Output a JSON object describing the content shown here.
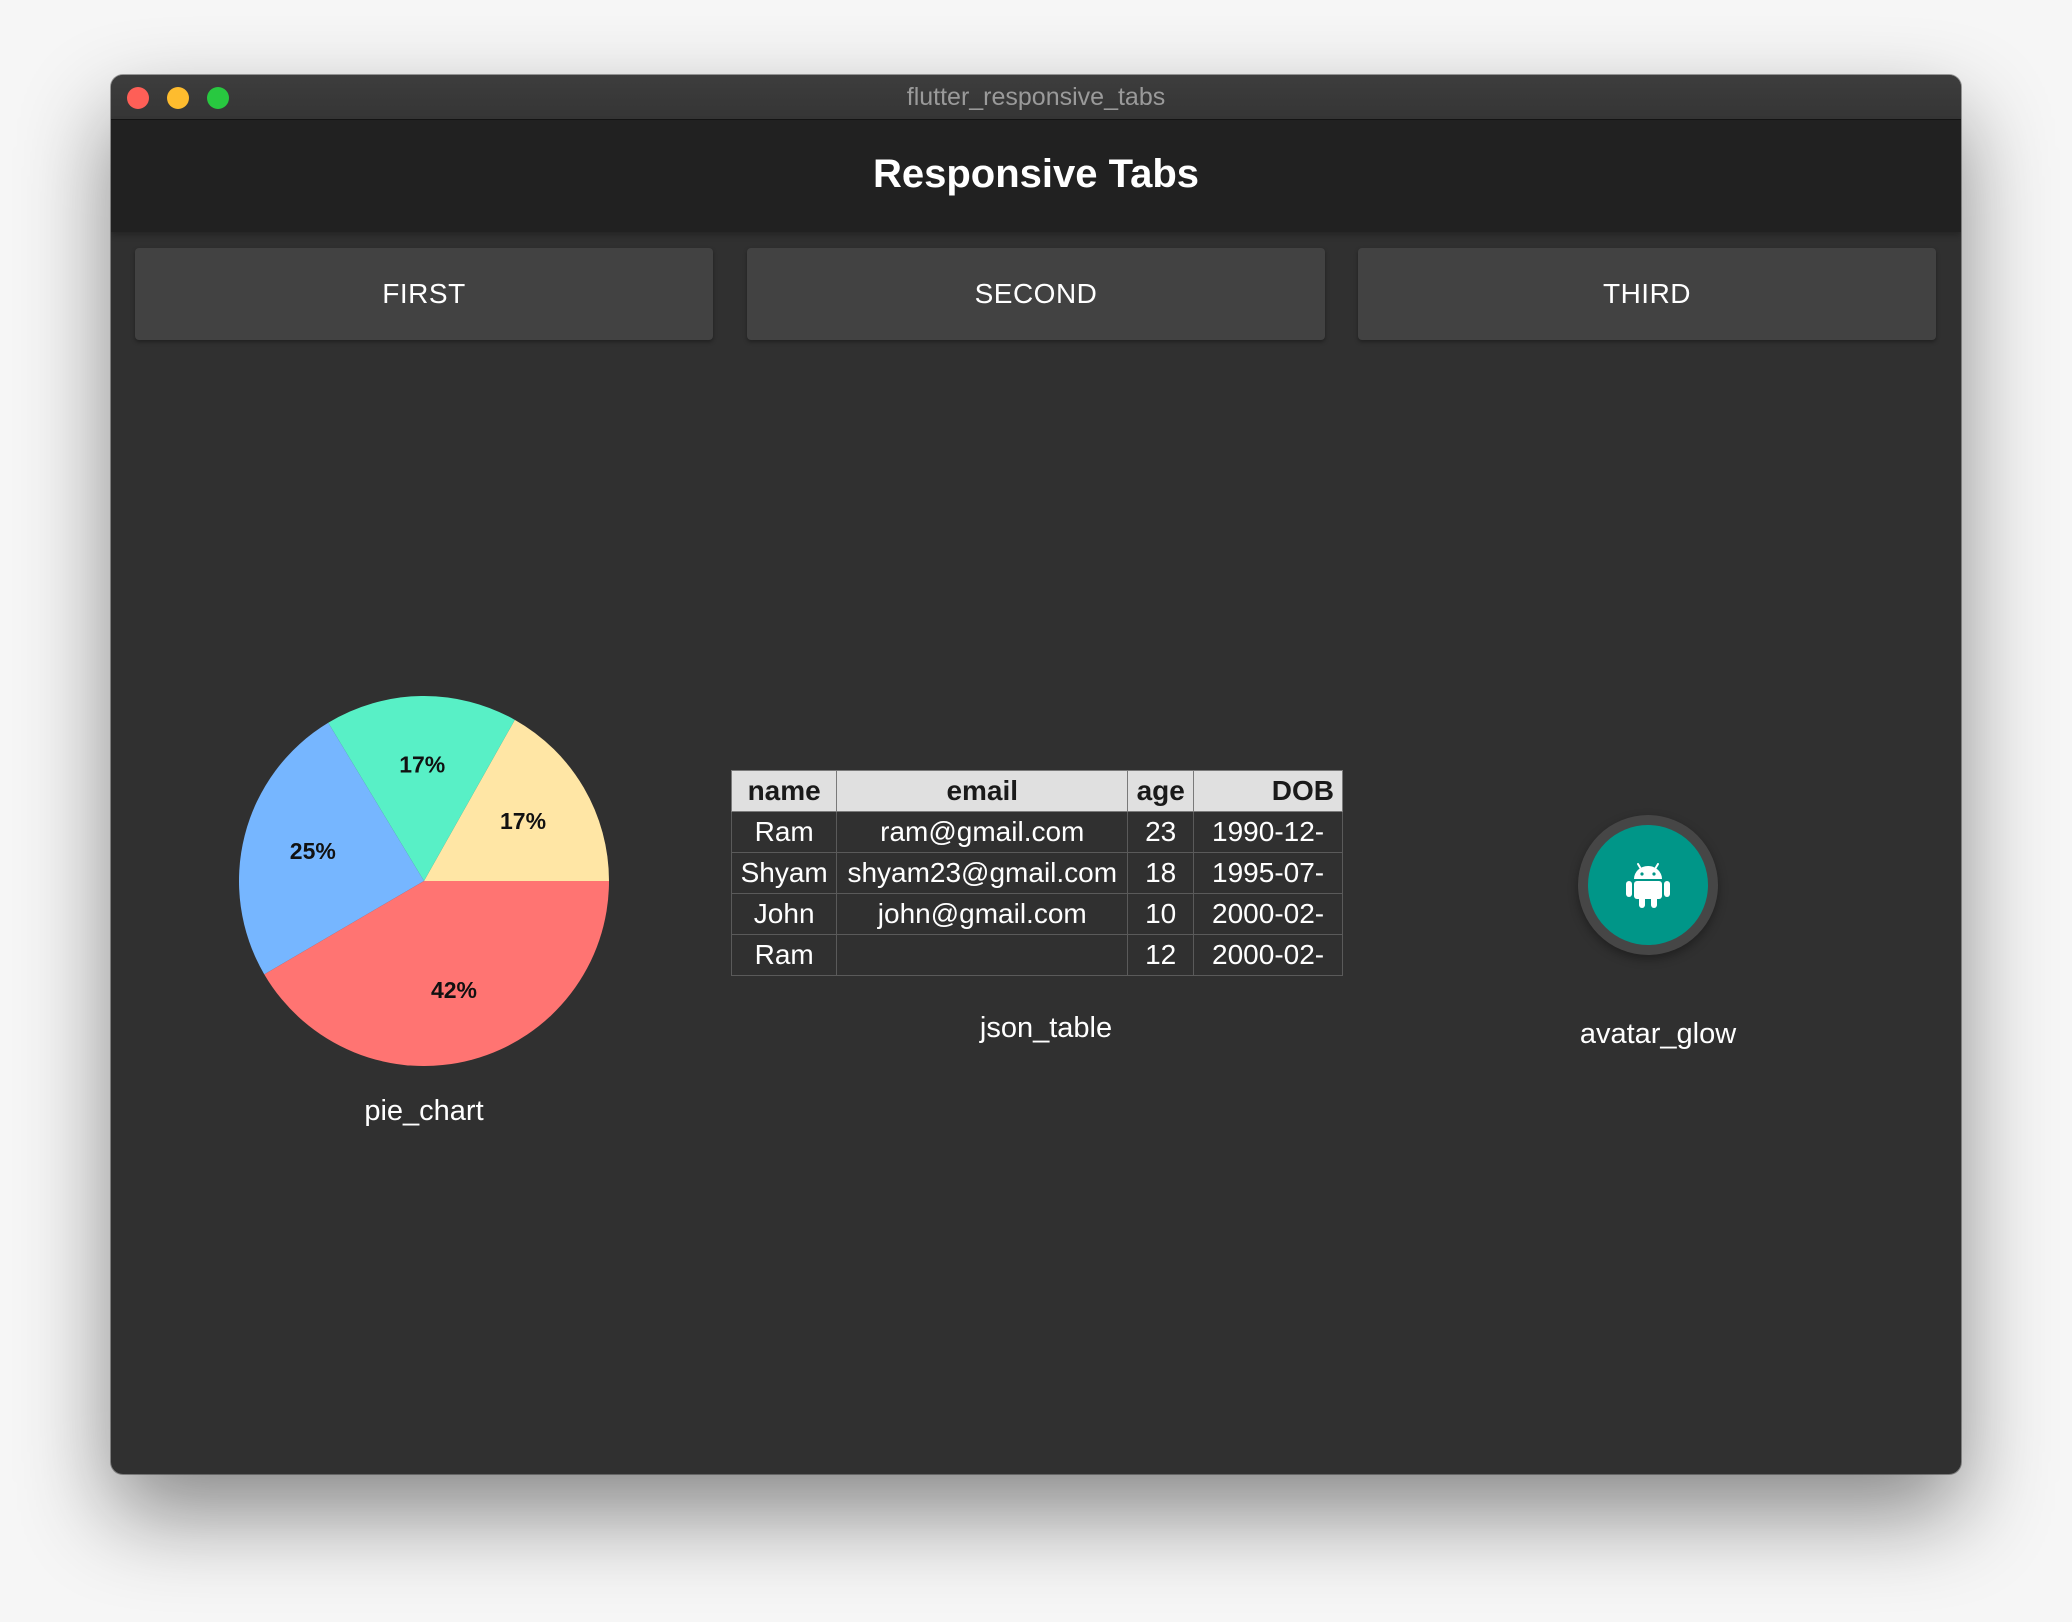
{
  "window": {
    "title": "flutter_responsive_tabs"
  },
  "appbar": {
    "title": "Responsive Tabs"
  },
  "tabs": [
    {
      "label": "FIRST"
    },
    {
      "label": "SECOND"
    },
    {
      "label": "THIRD"
    }
  ],
  "pie": {
    "caption": "pie_chart"
  },
  "table": {
    "caption": "json_table",
    "headers": [
      "name",
      "email",
      "age",
      "DOB"
    ],
    "rows": [
      {
        "name": "Ram",
        "email": "ram@gmail.com",
        "age": "23",
        "dob": "1990-12-"
      },
      {
        "name": "Shyam",
        "email": "shyam23@gmail.com",
        "age": "18",
        "dob": "1995-07-"
      },
      {
        "name": "John",
        "email": "john@gmail.com",
        "age": "10",
        "dob": "2000-02-"
      },
      {
        "name": "Ram",
        "email": "",
        "age": "12",
        "dob": "2000-02-"
      }
    ]
  },
  "avatar_glow": {
    "caption": "avatar_glow",
    "icon": "android-icon",
    "color": "#009688"
  },
  "chart_data": {
    "type": "pie",
    "slices": [
      {
        "label": "17%",
        "value": 17,
        "color": "#ffe6a5"
      },
      {
        "label": "17%",
        "value": 17,
        "color": "#58f0c6"
      },
      {
        "label": "25%",
        "value": 25,
        "color": "#76b6ff"
      },
      {
        "label": "42%",
        "value": 42,
        "color": "#ff7472"
      }
    ],
    "start_angle_deg": 0,
    "direction": "counter-clockwise"
  }
}
